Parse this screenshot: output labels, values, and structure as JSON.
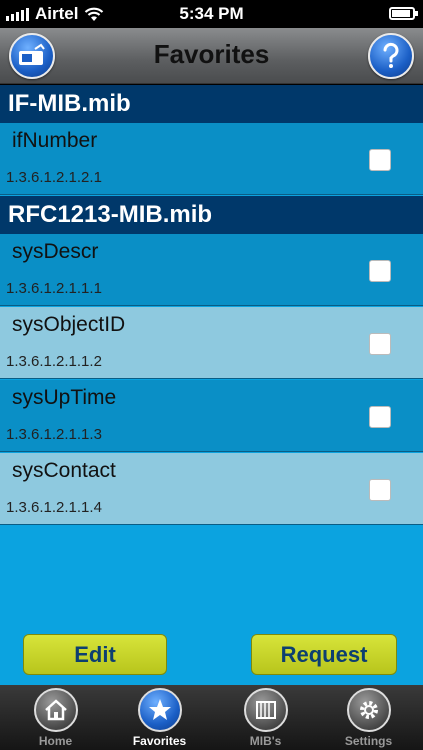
{
  "status": {
    "carrier": "Airtel",
    "time": "5:34 PM"
  },
  "nav": {
    "title": "Favorites"
  },
  "sections": [
    {
      "title": "IF-MIB.mib"
    },
    {
      "title": "RFC1213-MIB.mib"
    }
  ],
  "rows": [
    {
      "name": "ifNumber",
      "oid": "1.3.6.1.2.1.2.1"
    },
    {
      "name": "sysDescr",
      "oid": "1.3.6.1.2.1.1.1"
    },
    {
      "name": "sysObjectID",
      "oid": "1.3.6.1.2.1.1.2"
    },
    {
      "name": "sysUpTime",
      "oid": "1.3.6.1.2.1.1.3"
    },
    {
      "name": "sysContact",
      "oid": "1.3.6.1.2.1.1.4"
    }
  ],
  "actions": {
    "edit": "Edit",
    "request": "Request"
  },
  "tabs": [
    {
      "label": "Home"
    },
    {
      "label": "Favorites"
    },
    {
      "label": "MIB's"
    },
    {
      "label": "Settings"
    }
  ]
}
